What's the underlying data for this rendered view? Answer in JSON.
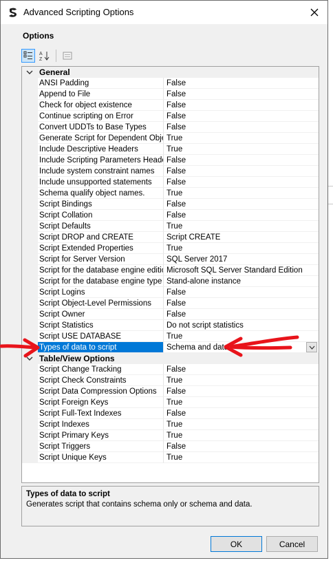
{
  "window": {
    "title": "Advanced Scripting Options"
  },
  "section_label": "Options",
  "toolbar": {
    "icons": [
      "categorized-view-icon",
      "alphabetical-sort-icon",
      "property-pages-icon"
    ]
  },
  "categories": [
    {
      "label": "General",
      "rows": [
        {
          "name": "ANSI Padding",
          "value": "False"
        },
        {
          "name": "Append to File",
          "value": "False"
        },
        {
          "name": "Check for object existence",
          "value": "False"
        },
        {
          "name": "Continue scripting on Error",
          "value": "False"
        },
        {
          "name": "Convert UDDTs to Base Types",
          "value": "False"
        },
        {
          "name": "Generate Script for Dependent Objects",
          "value": "True"
        },
        {
          "name": "Include Descriptive Headers",
          "value": "True"
        },
        {
          "name": "Include Scripting Parameters Header",
          "value": "False"
        },
        {
          "name": "Include system constraint names",
          "value": "False"
        },
        {
          "name": "Include unsupported statements",
          "value": "False"
        },
        {
          "name": "Schema qualify object names.",
          "value": "True"
        },
        {
          "name": "Script Bindings",
          "value": "False"
        },
        {
          "name": "Script Collation",
          "value": "False"
        },
        {
          "name": "Script Defaults",
          "value": "True"
        },
        {
          "name": "Script DROP and CREATE",
          "value": "Script CREATE"
        },
        {
          "name": "Script Extended Properties",
          "value": "True"
        },
        {
          "name": "Script for Server Version",
          "value": "SQL Server 2017"
        },
        {
          "name": "Script for the database engine edition",
          "value": "Microsoft SQL Server Standard Edition"
        },
        {
          "name": "Script for the database engine type",
          "value": "Stand-alone instance"
        },
        {
          "name": "Script Logins",
          "value": "False"
        },
        {
          "name": "Script Object-Level Permissions",
          "value": "False"
        },
        {
          "name": "Script Owner",
          "value": "False"
        },
        {
          "name": "Script Statistics",
          "value": "Do not script statistics"
        },
        {
          "name": "Script USE DATABASE",
          "value": "True"
        },
        {
          "name": "Types of data to script",
          "value": "Schema and data",
          "selected": true
        }
      ]
    },
    {
      "label": "Table/View Options",
      "rows": [
        {
          "name": "Script Change Tracking",
          "value": "False"
        },
        {
          "name": "Script Check Constraints",
          "value": "True"
        },
        {
          "name": "Script Data Compression Options",
          "value": "False"
        },
        {
          "name": "Script Foreign Keys",
          "value": "True"
        },
        {
          "name": "Script Full-Text Indexes",
          "value": "False"
        },
        {
          "name": "Script Indexes",
          "value": "True"
        },
        {
          "name": "Script Primary Keys",
          "value": "True"
        },
        {
          "name": "Script Triggers",
          "value": "False"
        },
        {
          "name": "Script Unique Keys",
          "value": "True"
        }
      ]
    }
  ],
  "description": {
    "title": "Types of data to script",
    "text": "Generates script that contains schema only or schema and data."
  },
  "buttons": {
    "ok": "OK",
    "cancel": "Cancel"
  },
  "colors": {
    "selection": "#0078d7",
    "annotation_arrow": "#e8141b",
    "dialog_bg": "#f0f0f0"
  }
}
